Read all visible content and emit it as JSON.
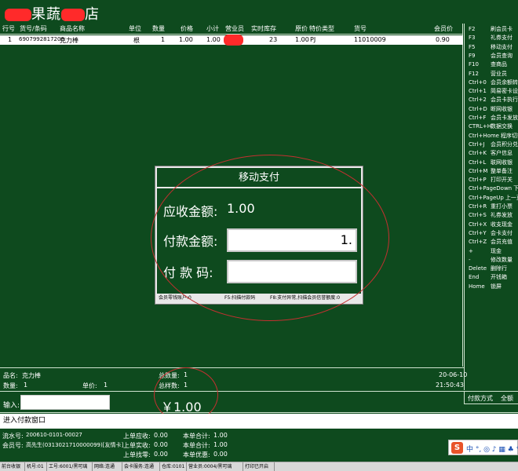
{
  "app": {
    "title_part1": "果蔬",
    "title_part2": "店"
  },
  "grid": {
    "headers": [
      "行号",
      "货号/条码",
      "商品名称",
      "单位",
      "数量",
      "价格",
      "小计",
      "营业员",
      "实时库存",
      "原价",
      "特价类型",
      "货号",
      "会员价"
    ],
    "rows": [
      {
        "line_no": "1",
        "barcode": "6907992817200",
        "name": "克力棒",
        "unit": "根",
        "qty": "1",
        "price": "1.00",
        "subtotal": "1.00",
        "clerk": "",
        "stock": "23",
        "original_price": "1.00",
        "special_type": "PJ",
        "item_no": "11010009",
        "member_price": "0.90"
      }
    ]
  },
  "shortcuts": [
    {
      "key": "F2",
      "label": "刷会员卡"
    },
    {
      "key": "F3",
      "label": "礼券支付"
    },
    {
      "key": "F5",
      "label": "移动支付"
    },
    {
      "key": "F9",
      "label": "会员查询"
    },
    {
      "key": "F10",
      "label": "查商品"
    },
    {
      "key": "F12",
      "label": "营业员"
    },
    {
      "key": "Ctrl+0",
      "label": "会员余额转账"
    },
    {
      "key": "Ctrl+1",
      "label": "简易密卡设置"
    },
    {
      "key": "Ctrl+2",
      "label": "会员卡执行"
    },
    {
      "key": "Ctrl+D",
      "label": "断网收银"
    },
    {
      "key": "Ctrl+F",
      "label": "会员卡发放"
    },
    {
      "key": "CTRL+H",
      "label": "数据交换"
    },
    {
      "key": "Ctrl+Home",
      "label": "程序切换"
    },
    {
      "key": "Ctrl+J",
      "label": "会员积分兑换"
    },
    {
      "key": "Ctrl+K",
      "label": "客户信息"
    },
    {
      "key": "Ctrl+L",
      "label": "联网收银"
    },
    {
      "key": "Ctrl+M",
      "label": "整单备注"
    },
    {
      "key": "Ctrl+P",
      "label": "打印开关"
    },
    {
      "key": "Ctrl+PageDown",
      "label": "下一页"
    },
    {
      "key": "Ctrl+PageUp",
      "label": "上一页"
    },
    {
      "key": "Ctrl+R",
      "label": "重打小票"
    },
    {
      "key": "Ctrl+S",
      "label": "礼券发放"
    },
    {
      "key": "Ctrl+X",
      "label": "收支现金"
    },
    {
      "key": "Ctrl+Y",
      "label": "会卡支付"
    },
    {
      "key": "Ctrl+Z",
      "label": "会员充值"
    },
    {
      "key": "+",
      "label": "现金"
    },
    {
      "key": "-",
      "label": "修改数量"
    },
    {
      "key": "Delete",
      "label": "删除行"
    },
    {
      "key": "End",
      "label": "开钱箱"
    },
    {
      "key": "Home",
      "label": "锁屏"
    }
  ],
  "dialog": {
    "title": "移动支付",
    "amount_due_label": "应收金额:",
    "amount_due_value": "1.00",
    "payment_label": "付款金额:",
    "payment_value": "1.",
    "code_label": "付 款 码:",
    "code_value": "",
    "status": [
      "会员零钱账户:0",
      "F5:扫描付款码",
      "F8:支付异常,扫描会员信誉额度:0"
    ]
  },
  "info": {
    "product_name_label": "品名:",
    "product_name": "克力棒",
    "qty_label": "数量:",
    "qty": "1",
    "unit_price_label": "单价:",
    "unit_price": "1",
    "total_qty_label": "总数量:",
    "total_qty": "1",
    "total_sku_label": "总样数:",
    "total_sku": "1",
    "date": "20-06-10",
    "time": "21:50:43"
  },
  "input": {
    "label": "输入:",
    "value": "",
    "total_amount": "￥1.00",
    "pay_mode_label": "付款方式",
    "pay_mode_value": "全额"
  },
  "prompt": "进入付款窗口",
  "summary": {
    "serial_label": "流水号:",
    "serial": "200610-0101-00027",
    "member_label": "会员号:",
    "member": "高先生(0313021710000099)[友情卡]",
    "prev_due_label": "上单应收:",
    "prev_due": "0.00",
    "prev_paid_label": "上单实收:",
    "prev_paid": "0.00",
    "prev_change_label": "上单找零:",
    "prev_change": "0.00",
    "cur_total_label": "本单合计:",
    "cur_total": "1.00",
    "cur_sum_label": "本单合计:",
    "cur_sum": "1.00",
    "cur_discount_label": "本单优惠:",
    "cur_discount": "0.00"
  },
  "ime": {
    "logo": "S",
    "text": "中 °, ◎ ♪ ▦ ♣ ✎"
  },
  "status_bar": [
    "前台收银",
    "机号:01",
    "工号:6001/黑可璃",
    "网络:连通",
    "会卡服务:连通",
    "仓库:0101",
    "营业员:0004/黑可璃",
    "打印已开启"
  ]
}
